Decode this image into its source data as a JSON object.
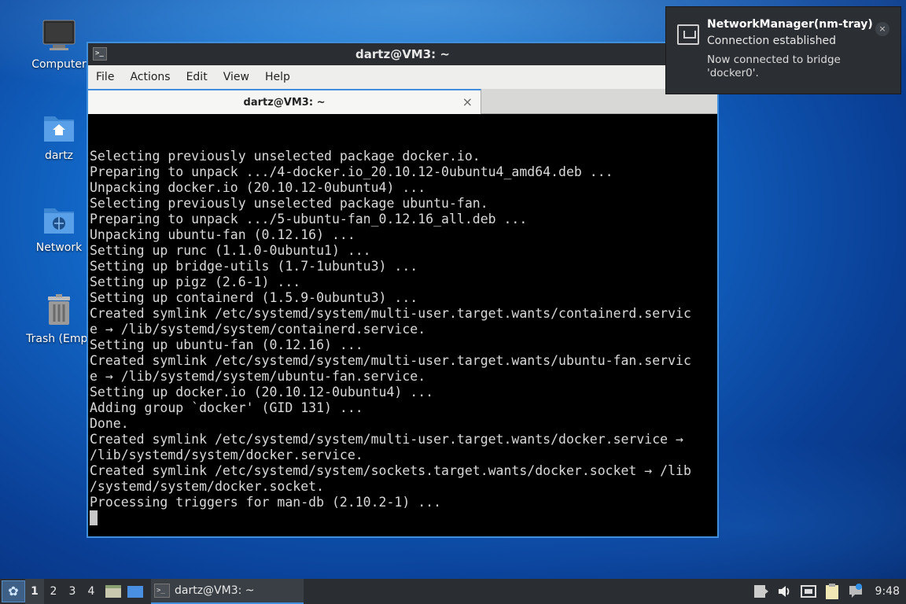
{
  "desktop": {
    "icons": [
      {
        "label": "Computer"
      },
      {
        "label": "dartz"
      },
      {
        "label": "Network"
      },
      {
        "label": "Trash (Empt"
      }
    ]
  },
  "window": {
    "title": "dartz@VM3: ~",
    "menu": [
      "File",
      "Actions",
      "Edit",
      "View",
      "Help"
    ],
    "tab_label": "dartz@VM3: ~",
    "tab_close": "×",
    "terminal_lines": [
      "Selecting previously unselected package docker.io.",
      "Preparing to unpack .../4-docker.io_20.10.12-0ubuntu4_amd64.deb ...",
      "Unpacking docker.io (20.10.12-0ubuntu4) ...",
      "Selecting previously unselected package ubuntu-fan.",
      "Preparing to unpack .../5-ubuntu-fan_0.12.16_all.deb ...",
      "Unpacking ubuntu-fan (0.12.16) ...",
      "Setting up runc (1.1.0-0ubuntu1) ...",
      "Setting up bridge-utils (1.7-1ubuntu3) ...",
      "Setting up pigz (2.6-1) ...",
      "Setting up containerd (1.5.9-0ubuntu3) ...",
      "Created symlink /etc/systemd/system/multi-user.target.wants/containerd.servic",
      "e → /lib/systemd/system/containerd.service.",
      "Setting up ubuntu-fan (0.12.16) ...",
      "Created symlink /etc/systemd/system/multi-user.target.wants/ubuntu-fan.servic",
      "e → /lib/systemd/system/ubuntu-fan.service.",
      "Setting up docker.io (20.10.12-0ubuntu4) ...",
      "Adding group `docker' (GID 131) ...",
      "Done.",
      "Created symlink /etc/systemd/system/multi-user.target.wants/docker.service →",
      "/lib/systemd/system/docker.service.",
      "Created symlink /etc/systemd/system/sockets.target.wants/docker.socket → /lib",
      "/systemd/system/docker.socket.",
      "Processing triggers for man-db (2.10.2-1) ..."
    ]
  },
  "notification": {
    "title": "NetworkManager(nm-tray)",
    "subtitle": "Connection established",
    "body": "Now connected to bridge 'docker0'.",
    "close": "×"
  },
  "taskbar": {
    "workspaces": [
      "1",
      "2",
      "3",
      "4"
    ],
    "active_workspace": "1",
    "task_label": "dartz@VM3: ~",
    "clock": "9:48"
  },
  "colors": {
    "accent": "#3f8fdc",
    "panel": "#2a2e33"
  }
}
